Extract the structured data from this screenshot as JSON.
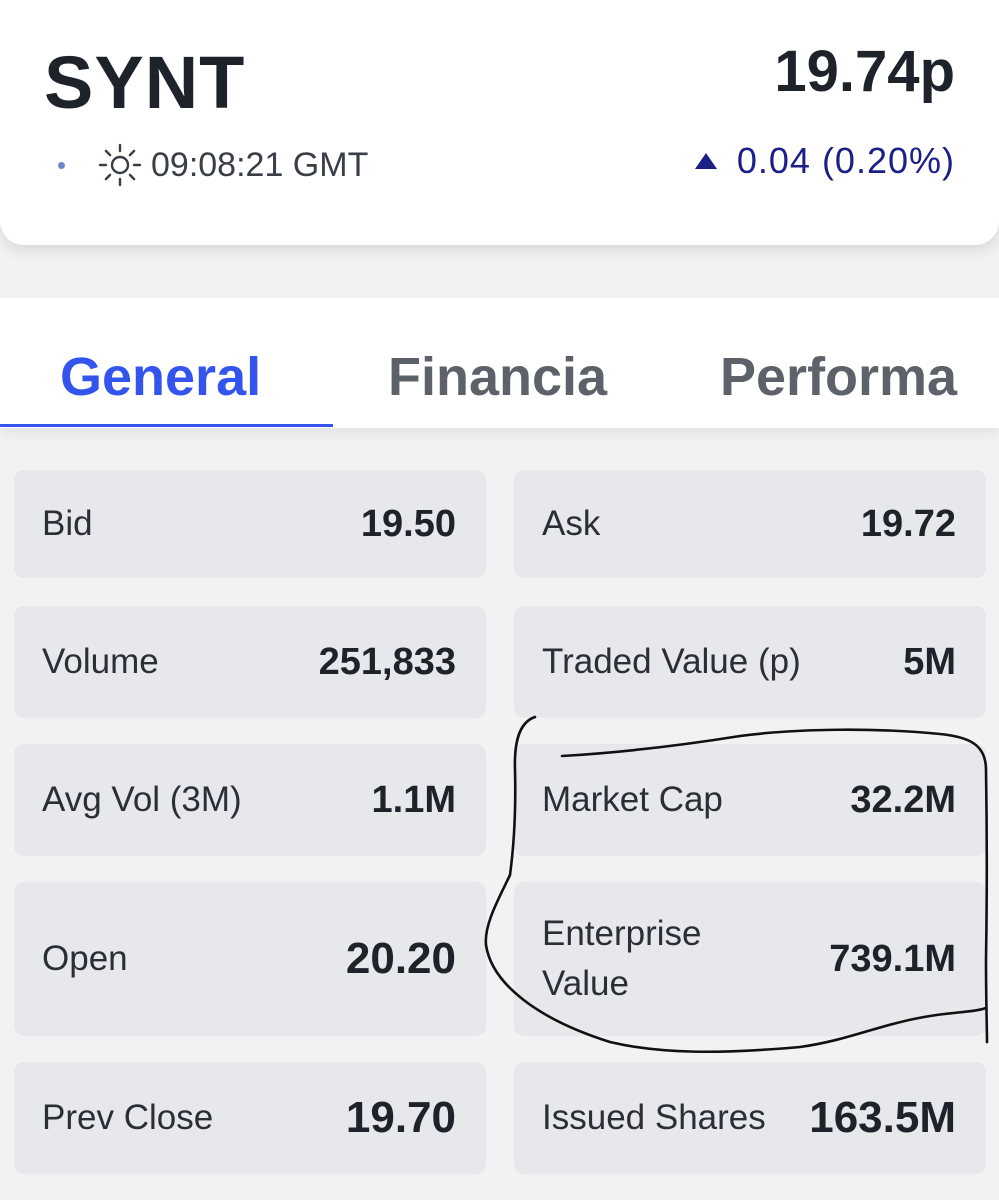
{
  "header": {
    "ticker": "SYNT",
    "price": "19.74p",
    "market_time": "09:08:21 GMT",
    "change": "0.04 (0.20%)",
    "change_color": "#1b1f86"
  },
  "tabs": [
    {
      "label": "General",
      "active": true
    },
    {
      "label": "Financia",
      "active": false
    },
    {
      "label": "Performa",
      "active": false
    }
  ],
  "stats": {
    "bid": {
      "label": "Bid",
      "value": "19.50"
    },
    "ask": {
      "label": "Ask",
      "value": "19.72"
    },
    "volume": {
      "label": "Volume",
      "value": "251,833"
    },
    "traded_value": {
      "label": "Traded Value (p)",
      "value": "5M"
    },
    "avg_vol": {
      "label": "Avg Vol (3M)",
      "value": "1.1M"
    },
    "market_cap": {
      "label": "Market Cap",
      "value": "32.2M"
    },
    "open": {
      "label": "Open",
      "value": "20.20"
    },
    "enterprise_value": {
      "label": "Enterprise Value",
      "value": "739.1M"
    },
    "prev_close": {
      "label": "Prev Close",
      "value": "19.70"
    },
    "issued_shares": {
      "label": "Issued Shares",
      "value": "163.5M"
    }
  },
  "colors": {
    "accent": "#3355ee",
    "card_bg": "#e7e8ec",
    "page_bg": "#f1f2f4"
  },
  "icons": [
    "sun-icon",
    "triangle-up-icon"
  ]
}
